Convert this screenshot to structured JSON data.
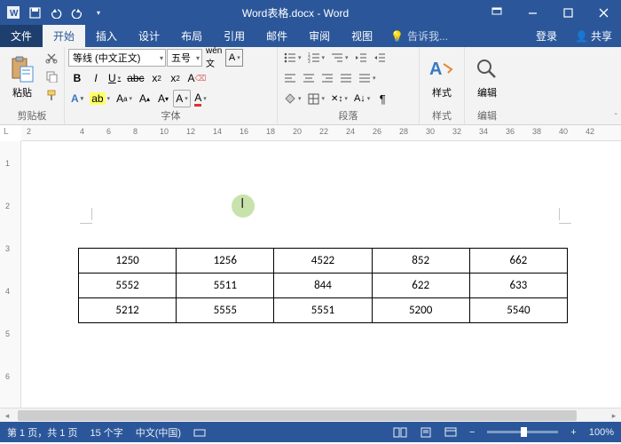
{
  "title": "Word表格.docx - Word",
  "tabs": {
    "file": "文件",
    "home": "开始",
    "insert": "插入",
    "design": "设计",
    "layout": "布局",
    "references": "引用",
    "mailings": "邮件",
    "review": "审阅",
    "view": "视图"
  },
  "tellme": "告诉我...",
  "signin": "登录",
  "share": "共享",
  "groups": {
    "clipboard": "剪贴板",
    "font": "字体",
    "paragraph": "段落",
    "styles": "样式",
    "editing": "编辑"
  },
  "clipboard": {
    "paste": "粘贴"
  },
  "font": {
    "name": "等线 (中文正文)",
    "size": "五号"
  },
  "styles": {
    "label": "样式"
  },
  "editing": {
    "label": "编辑"
  },
  "ruler": {
    "marks": [
      "2",
      "",
      "4",
      "6",
      "8",
      "10",
      "12",
      "14",
      "16",
      "18",
      "20",
      "22",
      "24",
      "26",
      "28",
      "30",
      "32",
      "34",
      "36",
      "38",
      "40",
      "42"
    ]
  },
  "vruler": [
    "1",
    "2",
    "3",
    "4",
    "5",
    "6"
  ],
  "lcorner": "L",
  "table": [
    [
      "1250",
      "1256",
      "4522",
      "852",
      "662"
    ],
    [
      "5552",
      "5511",
      "844",
      "622",
      "633"
    ],
    [
      "5212",
      "5555",
      "5551",
      "5200",
      "5540"
    ]
  ],
  "status": {
    "page": "第 1 页，共 1 页",
    "words": "15 个字",
    "lang": "中文(中国)",
    "zoom": "100%"
  }
}
